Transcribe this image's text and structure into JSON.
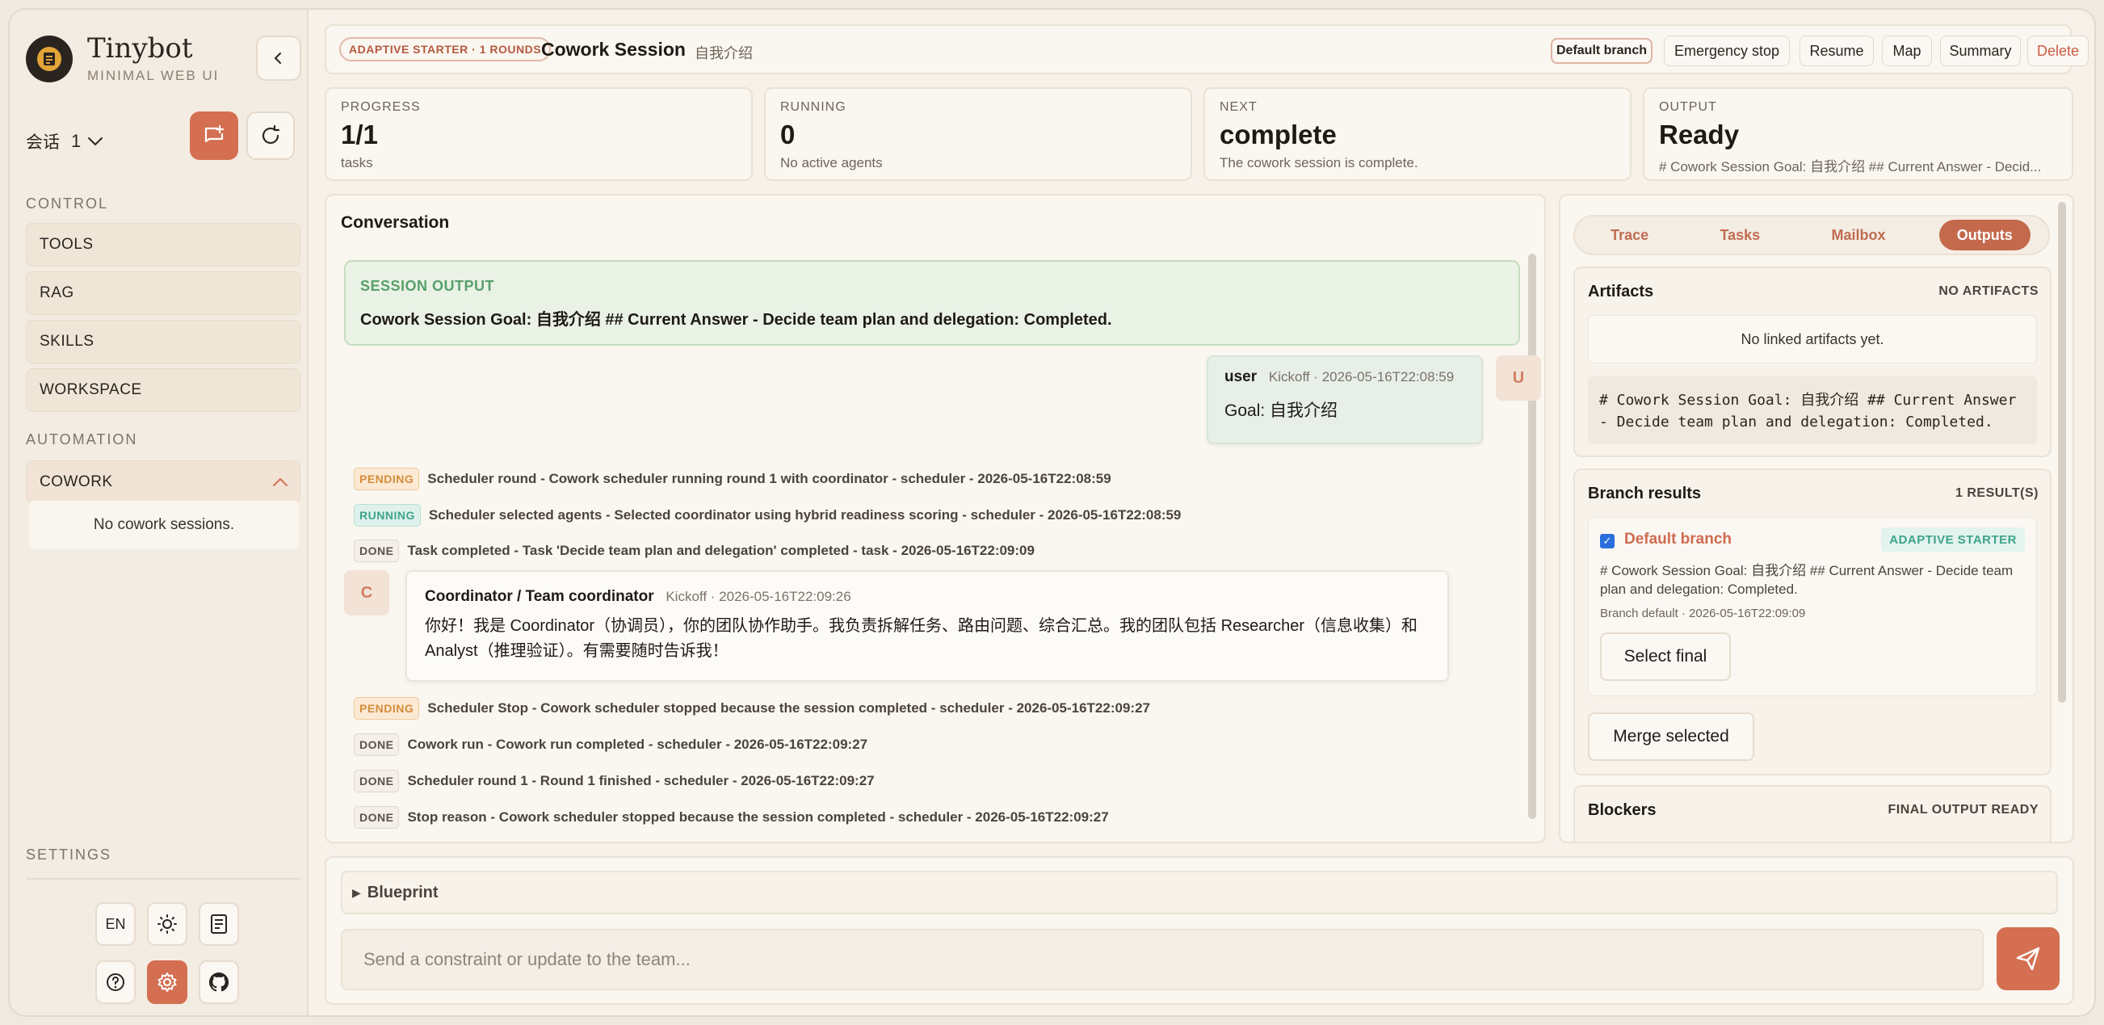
{
  "app": {
    "name": "Tinybot",
    "subtitle": "MINIMAL WEB UI",
    "logo_glyph": "≡"
  },
  "sidebar": {
    "session_label": "会话",
    "session_count": "1",
    "sections": {
      "control": "CONTROL",
      "automation": "AUTOMATION",
      "settings": "SETTINGS"
    },
    "control_items": [
      "TOOLS",
      "RAG",
      "SKILLS",
      "WORKSPACE"
    ],
    "cowork": {
      "label": "COWORK",
      "empty": "No cowork sessions."
    },
    "footer": {
      "language": "EN"
    }
  },
  "topbar": {
    "strategy_badge": "ADAPTIVE STARTER · 1 ROUNDS",
    "title": "Cowork Session",
    "subtitle": "自我介绍",
    "buttons": {
      "branch": "Default branch",
      "emergency": "Emergency stop",
      "resume": "Resume",
      "map": "Map",
      "summary": "Summary",
      "delete": "Delete"
    }
  },
  "stats": {
    "progress": {
      "label": "PROGRESS",
      "value": "1/1",
      "sub": "tasks"
    },
    "running": {
      "label": "RUNNING",
      "value": "0",
      "sub": "No active agents"
    },
    "next": {
      "label": "NEXT",
      "value": "complete",
      "sub": "The cowork session is complete."
    },
    "output": {
      "label": "OUTPUT",
      "value": "Ready",
      "sub": "# Cowork Session Goal: 自我介绍 ## Current Answer - Decid..."
    }
  },
  "conversation": {
    "title": "Conversation",
    "session_output": {
      "label": "SESSION OUTPUT",
      "text": "Cowork Session Goal: 自我介绍 ## Current Answer - Decide team plan and delegation: Completed."
    },
    "user_message": {
      "avatar": "U",
      "author": "user",
      "meta": "Kickoff · 2026-05-16T22:08:59",
      "body": "Goal: 自我介绍"
    },
    "events_before": [
      {
        "status": "PENDING",
        "kind": "pending",
        "text": "Scheduler round - Cowork scheduler running round 1 with coordinator - scheduler - 2026-05-16T22:08:59"
      },
      {
        "status": "RUNNING",
        "kind": "running",
        "text": "Scheduler selected agents - Selected coordinator using hybrid readiness scoring - scheduler - 2026-05-16T22:08:59"
      },
      {
        "status": "DONE",
        "kind": "done",
        "text": "Task completed - Task 'Decide team plan and delegation' completed - task - 2026-05-16T22:09:09"
      }
    ],
    "coordinator_message": {
      "avatar": "C",
      "author": "Coordinator / Team coordinator",
      "meta": "Kickoff · 2026-05-16T22:09:26",
      "body": "你好！我是 Coordinator（协调员），你的团队协作助手。我负责拆解任务、路由问题、综合汇总。我的团队包括 Researcher（信息收集）和 Analyst（推理验证）。有需要随时告诉我！"
    },
    "events_after": [
      {
        "status": "PENDING",
        "kind": "pending",
        "text": "Scheduler Stop - Cowork scheduler stopped because the session completed - scheduler - 2026-05-16T22:09:27"
      },
      {
        "status": "DONE",
        "kind": "done",
        "text": "Cowork run - Cowork run completed - scheduler - 2026-05-16T22:09:27"
      },
      {
        "status": "DONE",
        "kind": "done",
        "text": "Scheduler round 1 - Round 1 finished - scheduler - 2026-05-16T22:09:27"
      },
      {
        "status": "DONE",
        "kind": "done",
        "text": "Stop reason - Cowork scheduler stopped because the session completed - scheduler - 2026-05-16T22:09:27"
      }
    ]
  },
  "side_panel": {
    "tabs": [
      "Trace",
      "Tasks",
      "Mailbox",
      "Outputs"
    ],
    "active_tab": "Outputs",
    "artifacts": {
      "title": "Artifacts",
      "meta": "NO ARTIFACTS",
      "empty": "No linked artifacts yet.",
      "preview": "# Cowork Session Goal: 自我介绍 ## Current Answer - Decide team plan and delegation: Completed."
    },
    "branch_results": {
      "title": "Branch results",
      "meta": "1 RESULT(S)",
      "branch": {
        "name": "Default branch",
        "tag": "ADAPTIVE STARTER",
        "text": "# Cowork Session Goal: 自我介绍 ## Current Answer - Decide team plan and delegation: Completed.",
        "time": "Branch default · 2026-05-16T22:09:09",
        "select_label": "Select final"
      },
      "merge_label": "Merge selected"
    },
    "blockers": {
      "title": "Blockers",
      "meta": "FINAL OUTPUT READY"
    }
  },
  "composer": {
    "blueprint_label": "Blueprint",
    "placeholder": "Send a constraint or update to the team..."
  },
  "colors": {
    "accent": "#d46f52",
    "background": "#f6f1e9",
    "success": "#57a06a",
    "running": "#3ea489",
    "pending": "#d48c3a"
  }
}
